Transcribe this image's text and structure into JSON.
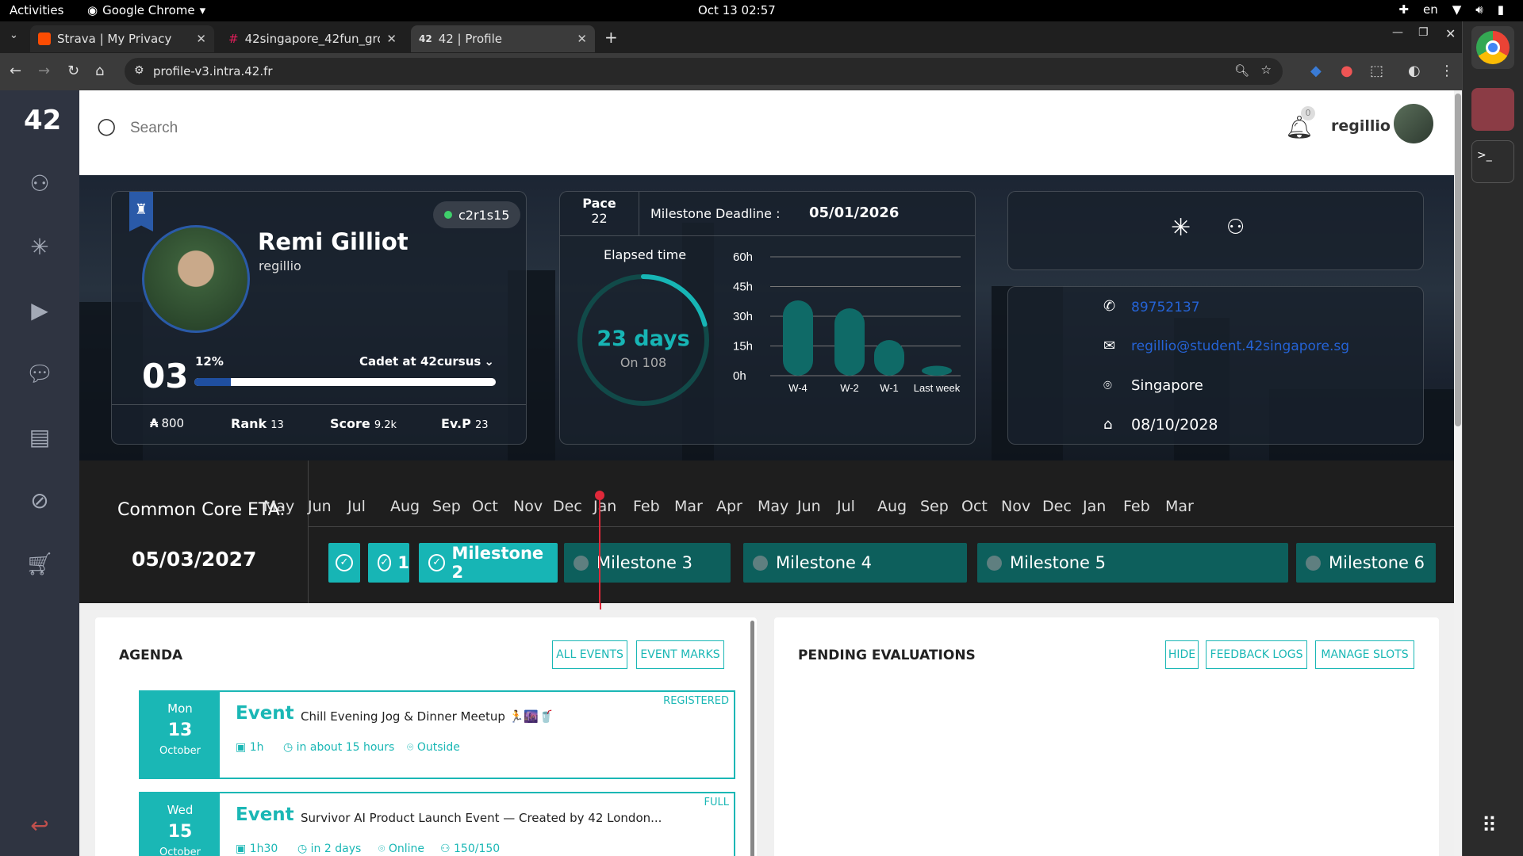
{
  "system": {
    "activities": "Activities",
    "app_name": "Google Chrome",
    "clock": "Oct 13  02:57",
    "lang": "en"
  },
  "browser": {
    "tabs": [
      {
        "title": "Strava | My Privacy"
      },
      {
        "title": "42singapore_42fun_gro"
      },
      {
        "title": "42 | Profile"
      }
    ],
    "url": "profile-v3.intra.42.fr"
  },
  "header": {
    "search_placeholder": "Search",
    "notif_count": "0",
    "username": "regillio"
  },
  "profile": {
    "name": "Remi Gilliot",
    "login": "regillio",
    "status": "c2r1s15",
    "level": "03",
    "level_pct": "12%",
    "level_progress": 0.12,
    "cursus": "Cadet at 42cursus",
    "wallet": "800",
    "rank_label": "Rank",
    "rank": "13",
    "score_label": "Score",
    "score": "9.2k",
    "evp_label": "Ev.P",
    "evp": "23"
  },
  "pace": {
    "label": "Pace",
    "value": "22",
    "deadline_label": "Milestone Deadline :",
    "deadline": "05/01/2026",
    "elapsed_label": "Elapsed time",
    "days": "23 days",
    "on": "On 108",
    "elapsed_fraction": 0.21
  },
  "chart_data": {
    "type": "bar",
    "categories": [
      "W-4",
      "W-2",
      "W-1",
      "Last week"
    ],
    "values": [
      38,
      34,
      18,
      5
    ],
    "yticks": [
      "60h",
      "45h",
      "30h",
      "15h",
      "0h"
    ],
    "ylim": [
      0,
      60
    ]
  },
  "contact": {
    "phone": "89752137",
    "email": "regillio@student.42singapore.sg",
    "location": "Singapore",
    "date": "08/10/2028"
  },
  "eta": {
    "label": "Common Core ETA:",
    "date": "05/03/2027",
    "months": [
      "May",
      "Jun",
      "Jul",
      "Aug",
      "Sep",
      "Oct",
      "Nov",
      "Dec",
      "Jan",
      "Feb",
      "Mar",
      "Apr",
      "May",
      "Jun",
      "Jul",
      "Aug",
      "Sep",
      "Oct",
      "Nov",
      "Dec",
      "Jan",
      "Feb",
      "Mar"
    ],
    "milestones": [
      {
        "label": "",
        "done": true
      },
      {
        "label": "1",
        "done": true
      },
      {
        "label": "Milestone 2",
        "done": true
      },
      {
        "label": "Milestone 3",
        "done": false
      },
      {
        "label": "Milestone 4",
        "done": false
      },
      {
        "label": "Milestone 5",
        "done": false
      },
      {
        "label": "Milestone 6",
        "done": false
      }
    ]
  },
  "agenda": {
    "title": "AGENDA",
    "all_events": "ALL EVENTS",
    "event_marks": "EVENT MARKS",
    "events": [
      {
        "day": "Mon",
        "num": "13",
        "month": "October",
        "type": "Event",
        "title": "Chill Evening Jog & Dinner Meetup 🏃🌆🥤",
        "badge": "REGISTERED",
        "duration": "1h",
        "when": "in about 15 hours",
        "where": "Outside",
        "capacity": ""
      },
      {
        "day": "Wed",
        "num": "15",
        "month": "October",
        "type": "Event",
        "title": "Survivor AI Product Launch Event — Created by 42 London...",
        "badge": "FULL",
        "duration": "1h30",
        "when": "in 2 days",
        "where": "Online",
        "capacity": "150/150"
      }
    ]
  },
  "evaluations": {
    "title": "PENDING EVALUATIONS",
    "hide": "HIDE",
    "feedback": "FEEDBACK LOGS",
    "slots": "MANAGE SLOTS"
  }
}
